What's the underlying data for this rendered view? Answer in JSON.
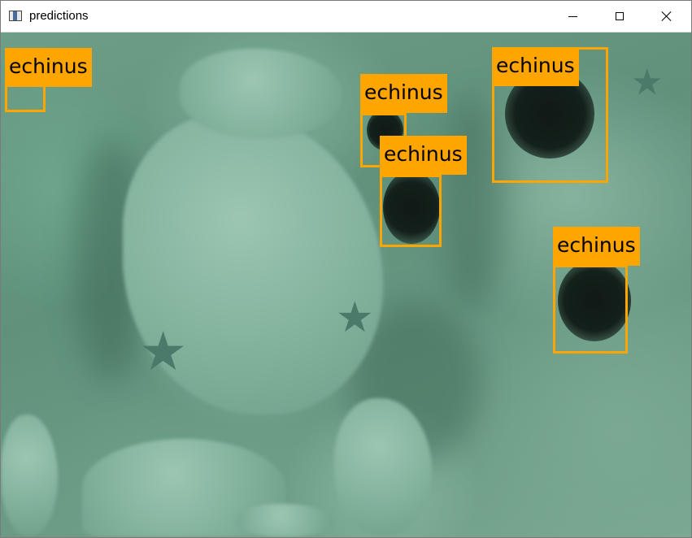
{
  "window": {
    "title": "predictions",
    "app_icon": "image-window-icon",
    "buttons": {
      "minimize": "minimize-icon",
      "maximize": "maximize-icon",
      "close": "close-icon"
    }
  },
  "theme": {
    "box_color": "#ffa500",
    "label_text_color": "#000000"
  },
  "detections": [
    {
      "label": "echinus"
    },
    {
      "label": "echinus"
    },
    {
      "label": "echinus"
    },
    {
      "label": "echinus"
    },
    {
      "label": "echinus"
    }
  ]
}
